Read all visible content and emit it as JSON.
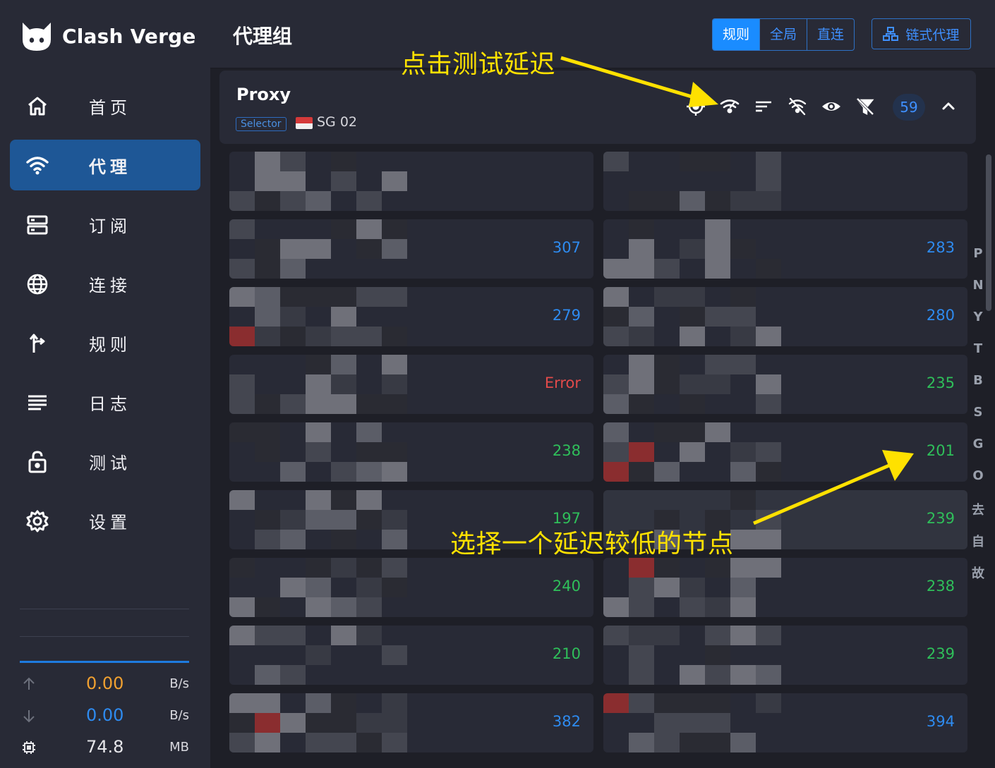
{
  "app": {
    "name": "Clash Verge"
  },
  "sidebar": {
    "items": [
      {
        "label": "首页",
        "icon": "home-icon"
      },
      {
        "label": "代理",
        "icon": "wifi-icon",
        "active": true
      },
      {
        "label": "订阅",
        "icon": "server-icon"
      },
      {
        "label": "连接",
        "icon": "globe-icon"
      },
      {
        "label": "规则",
        "icon": "fork-icon"
      },
      {
        "label": "日志",
        "icon": "list-icon"
      },
      {
        "label": "测试",
        "icon": "lock-icon"
      },
      {
        "label": "设置",
        "icon": "gear-icon"
      }
    ],
    "traffic": {
      "upload": {
        "value": "0.00",
        "unit": "B/s",
        "color": "#f0a030"
      },
      "download": {
        "value": "0.00",
        "unit": "B/s",
        "color": "#2e8bf0"
      },
      "memory": {
        "value": "74.8",
        "unit": "MB"
      }
    }
  },
  "header": {
    "title": "代理组",
    "modes": [
      "规则",
      "全局",
      "直连"
    ],
    "active_mode": "规则",
    "chain_label": "链式代理"
  },
  "group": {
    "name": "Proxy",
    "type": "Selector",
    "now": "SG 02",
    "count": "59"
  },
  "nodes": [
    {
      "delay": "",
      "status": "blue"
    },
    {
      "delay": "",
      "status": "blue"
    },
    {
      "delay": "307",
      "status": "blue"
    },
    {
      "delay": "283",
      "status": "blue"
    },
    {
      "delay": "279",
      "status": "blue"
    },
    {
      "delay": "280",
      "status": "blue"
    },
    {
      "delay": "Error",
      "status": "red"
    },
    {
      "delay": "235",
      "status": "green"
    },
    {
      "delay": "238",
      "status": "green"
    },
    {
      "delay": "201",
      "status": "green"
    },
    {
      "delay": "197",
      "status": "green"
    },
    {
      "delay": "239",
      "status": "green",
      "selected": true
    },
    {
      "delay": "240",
      "status": "green"
    },
    {
      "delay": "238",
      "status": "green"
    },
    {
      "delay": "210",
      "status": "green"
    },
    {
      "delay": "239",
      "status": "green"
    },
    {
      "delay": "382",
      "status": "blue"
    },
    {
      "delay": "394",
      "status": "blue"
    }
  ],
  "letter_index": [
    "P",
    "N",
    "Y",
    "T",
    "B",
    "S",
    "G",
    "O",
    "去",
    "自",
    "故"
  ],
  "annotations": {
    "test_delay": "点击测试延迟",
    "choose_node": "选择一个延迟较低的节点"
  },
  "colors": {
    "accent": "#1a8cff",
    "active_nav": "#1e5796",
    "annotation": "#ffe100"
  }
}
